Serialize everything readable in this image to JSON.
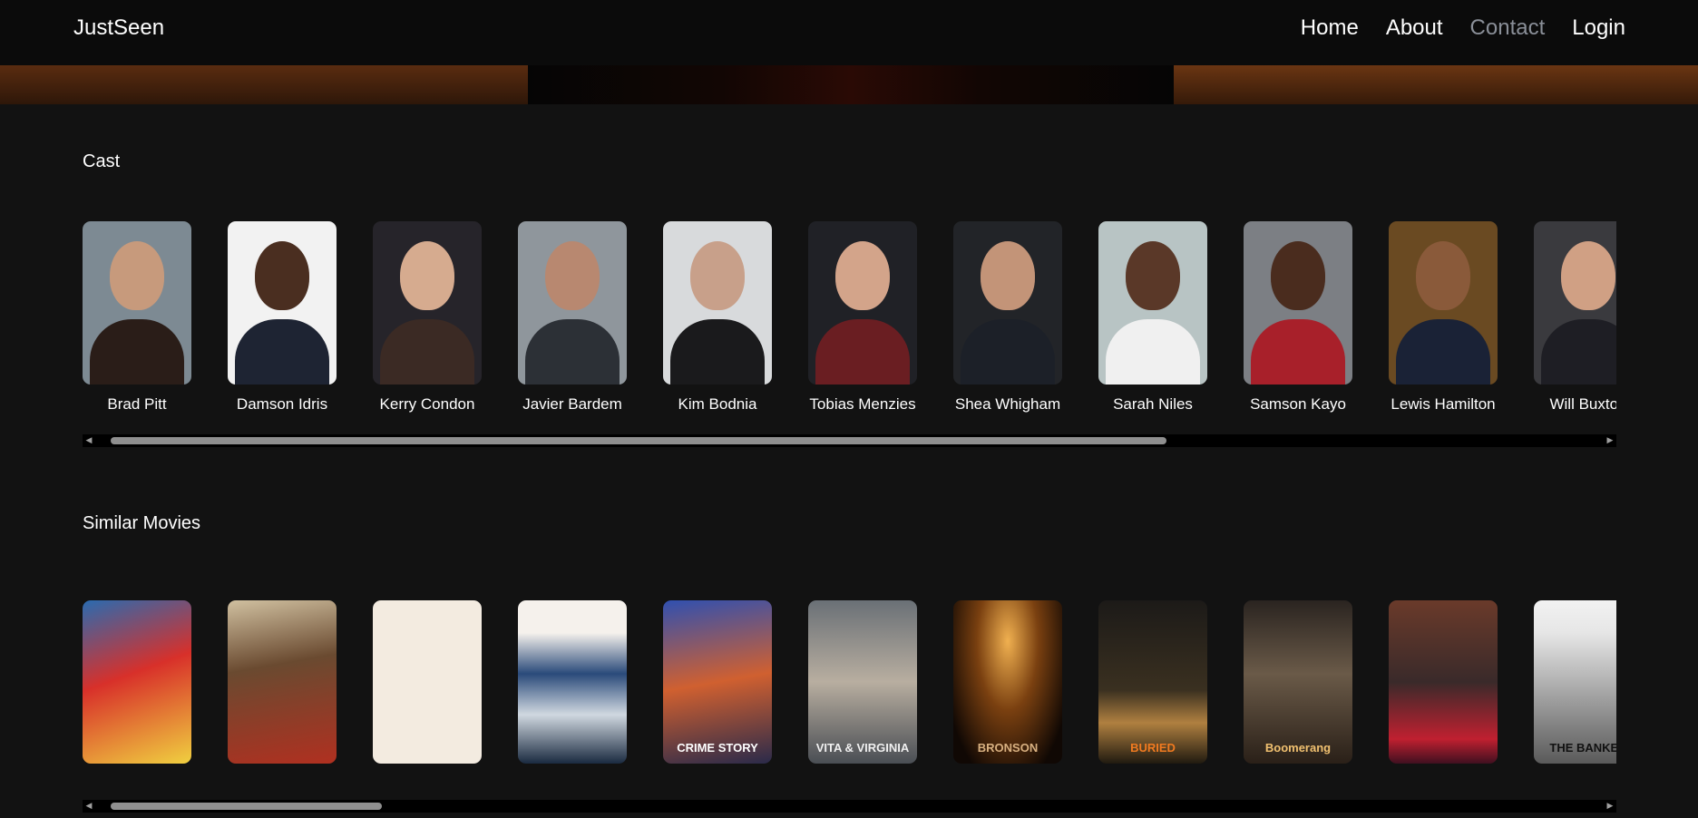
{
  "navbar": {
    "brand": "JustSeen",
    "links": [
      {
        "label": "Home",
        "active": false
      },
      {
        "label": "About",
        "active": false
      },
      {
        "label": "Contact",
        "active": true
      },
      {
        "label": "Login",
        "active": false
      }
    ]
  },
  "cast": {
    "title": "Cast",
    "members": [
      {
        "name": "Brad Pitt",
        "bg": "#7d8a93",
        "skin": "#c79a7c",
        "clothes": "#2a1d18"
      },
      {
        "name": "Damson Idris",
        "bg": "#f2f2f2",
        "skin": "#4a2e20",
        "clothes": "#1e2433"
      },
      {
        "name": "Kerry Condon",
        "bg": "#26242a",
        "skin": "#d6ab8f",
        "clothes": "#3b2a24"
      },
      {
        "name": "Javier Bardem",
        "bg": "#8f969c",
        "skin": "#b88870",
        "clothes": "#2c3036"
      },
      {
        "name": "Kim Bodnia",
        "bg": "#d8dadc",
        "skin": "#c8a08a",
        "clothes": "#1a1a1c"
      },
      {
        "name": "Tobias Menzies",
        "bg": "#202126",
        "skin": "#d3a48a",
        "clothes": "#6a1e22"
      },
      {
        "name": "Shea Whigham",
        "bg": "#222428",
        "skin": "#c39478",
        "clothes": "#1c2028"
      },
      {
        "name": "Sarah Niles",
        "bg": "#b8c4c4",
        "skin": "#5a3828",
        "clothes": "#f0f0f0"
      },
      {
        "name": "Samson Kayo",
        "bg": "#7c7f84",
        "skin": "#4a2c1e",
        "clothes": "#a8202a"
      },
      {
        "name": "Lewis Hamilton",
        "bg": "#6a4a22",
        "skin": "#8a5a3a",
        "clothes": "#1a2236"
      },
      {
        "name": "Will Buxton",
        "bg": "#3a3a3e",
        "skin": "#d0a084",
        "clothes": "#1e1e24"
      }
    ]
  },
  "similar": {
    "title": "Similar Movies",
    "movies": [
      {
        "title": "",
        "bg": "linear-gradient(160deg,#2a6bb0 0%,#d8302a 45%,#f0d040 100%)",
        "fg": "#ffe14a"
      },
      {
        "title": "",
        "bg": "linear-gradient(170deg,#d0c0a0 0%,#6a4a30 40%,#b03020 100%)",
        "fg": "#ffffff"
      },
      {
        "title": "",
        "bg": "linear-gradient(90deg,#f3ebe0 0%,#f3ebe0 100%)",
        "fg": "#c03020"
      },
      {
        "title": "",
        "bg": "linear-gradient(180deg,#f5f1ec 0%,#f5f1ec 20%,#2a4a7a 45%,#d0d8e0 70%,#1a2a40 100%)",
        "fg": "#d02030"
      },
      {
        "title": "CRIME STORY",
        "bg": "linear-gradient(170deg,#3050b0 0%,#d06030 50%,#2a2a4a 100%)",
        "fg": "#ffffff"
      },
      {
        "title": "VITA & VIRGINIA",
        "bg": "linear-gradient(180deg,#6a7076 0%,#b8aea0 50%,#4a4e54 100%)",
        "fg": "#f0f0f0"
      },
      {
        "title": "BRONSON",
        "bg": "radial-gradient(ellipse at 50% 25%,#f0b050 0%,#7a4010 40%,#100804 85%)",
        "fg": "#d8b080"
      },
      {
        "title": "BURIED",
        "bg": "linear-gradient(180deg,#1c1a18 0%,#3a3020 55%,#b08040 75%,#201a10 100%)",
        "fg": "#f07a20"
      },
      {
        "title": "Boomerang",
        "bg": "linear-gradient(180deg,#2a2420 0%,#6a5a48 45%,#2a2018 100%)",
        "fg": "#f0c070"
      },
      {
        "title": "",
        "bg": "linear-gradient(180deg,#6a3a2a 0%,#3a2a2a 50%,#c02030 85%,#401020 100%)",
        "fg": "#ff4050"
      },
      {
        "title": "THE BANKER",
        "bg": "linear-gradient(180deg,#f2f2f2 0%,#e6e6e6 20%,#a0a0a0 60%,#5a5a5a 100%)",
        "fg": "#111111"
      }
    ]
  },
  "scroll": {
    "cast_thumb_start": 0.01,
    "cast_thumb_fraction": 0.7,
    "similar_thumb_start": 0.01,
    "similar_thumb_fraction": 0.18
  }
}
